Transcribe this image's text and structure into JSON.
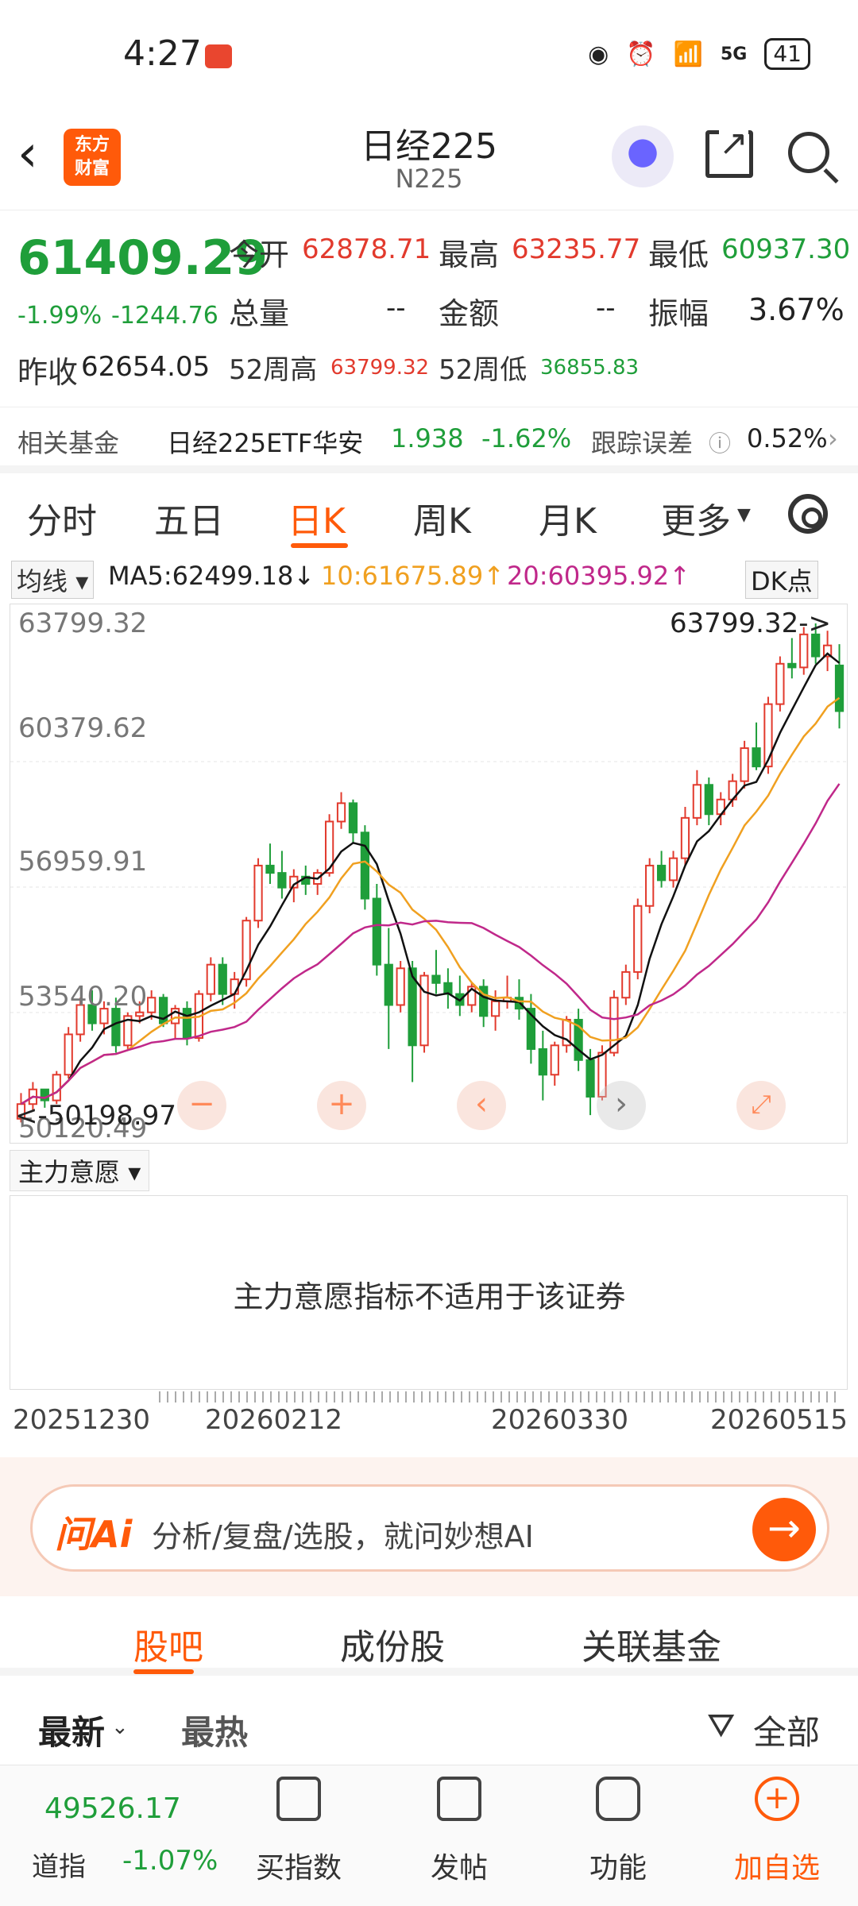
{
  "status_bar": {
    "time": "4:27",
    "network": "5G",
    "battery": "41"
  },
  "header": {
    "title": "日经225",
    "code": "N225",
    "logo_text": "东方\n财富"
  },
  "quote": {
    "price": "61409.29",
    "change_pct": "-1.99%",
    "change": "-1244.76",
    "prev_close_label": "昨收",
    "prev_close": "62654.05",
    "open_label": "今开",
    "open": "62878.71",
    "high_label": "最高",
    "high": "63235.77",
    "low_label": "最低",
    "low": "60937.30",
    "volume_label": "总量",
    "volume": "--",
    "amount_label": "金额",
    "amount": "--",
    "amplitude_label": "振幅",
    "amplitude": "3.67%",
    "high52_label": "52周高",
    "high52": "63799.32",
    "low52_label": "52周低",
    "low52": "36855.83"
  },
  "related_fund": {
    "label": "相关基金",
    "name": "日经225ETF华安",
    "price": "1.938",
    "change": "-1.62%",
    "error_label": "跟踪误差",
    "error_value": "0.52%"
  },
  "tabs": [
    "分时",
    "五日",
    "日K",
    "周K",
    "月K",
    "更多"
  ],
  "active_tab": "日K",
  "ma": {
    "selector": "均线",
    "ma5": "MA5:62499.18↓",
    "ma10": "10:61675.89↑",
    "ma20": "20:60395.92↑",
    "dk": "DK点"
  },
  "chart_data": {
    "type": "candlestick",
    "y_labels": [
      "63799.32",
      "60379.62",
      "56959.91",
      "53540.20",
      "50120.49"
    ],
    "ylim": [
      50120.49,
      63799.32
    ],
    "max_marker": "63799.32->",
    "min_marker": "<-50198.97",
    "x_labels": [
      "20251230",
      "20260212",
      "20260330",
      "20260515"
    ],
    "candles": [
      [
        50300,
        51000,
        50200,
        50700
      ],
      [
        50700,
        51300,
        50500,
        51100
      ],
      [
        51100,
        51000,
        50600,
        50800
      ],
      [
        50800,
        51600,
        50700,
        51500
      ],
      [
        51500,
        52800,
        51400,
        52600
      ],
      [
        52600,
        53600,
        52400,
        53400
      ],
      [
        53400,
        53800,
        52700,
        52900
      ],
      [
        52900,
        53500,
        52600,
        53300
      ],
      [
        53300,
        53600,
        52100,
        52300
      ],
      [
        52300,
        53200,
        52200,
        53100
      ],
      [
        53100,
        53500,
        52900,
        53200
      ],
      [
        53200,
        53800,
        53000,
        53600
      ],
      [
        53600,
        53700,
        52800,
        52900
      ],
      [
        52900,
        53400,
        52500,
        53300
      ],
      [
        53300,
        53500,
        52300,
        52500
      ],
      [
        52500,
        53800,
        52400,
        53700
      ],
      [
        53700,
        54700,
        53500,
        54500
      ],
      [
        54500,
        54700,
        53400,
        53700
      ],
      [
        53700,
        54300,
        53300,
        54100
      ],
      [
        54100,
        55800,
        53900,
        55700
      ],
      [
        55700,
        57400,
        55500,
        57200
      ],
      [
        57200,
        57800,
        56700,
        57000
      ],
      [
        57000,
        57600,
        56300,
        56600
      ],
      [
        56600,
        57100,
        56200,
        56900
      ],
      [
        56900,
        57200,
        56400,
        56700
      ],
      [
        56700,
        57100,
        56400,
        57000
      ],
      [
        57000,
        58600,
        56900,
        58400
      ],
      [
        58400,
        59200,
        58200,
        58900
      ],
      [
        58900,
        59000,
        57800,
        58100
      ],
      [
        58100,
        58300,
        56000,
        56300
      ],
      [
        56300,
        56700,
        54200,
        54500
      ],
      [
        54500,
        55500,
        52200,
        53400
      ],
      [
        53400,
        54600,
        53200,
        54400
      ],
      [
        54400,
        54600,
        51300,
        52300
      ],
      [
        52300,
        54300,
        52100,
        54200
      ],
      [
        54200,
        54900,
        53700,
        54000
      ],
      [
        54000,
        54400,
        53300,
        53700
      ],
      [
        53700,
        54200,
        53100,
        53400
      ],
      [
        53400,
        54000,
        53200,
        53900
      ],
      [
        53900,
        54100,
        52800,
        53100
      ],
      [
        53100,
        53800,
        52700,
        53500
      ],
      [
        53500,
        54200,
        53300,
        53600
      ],
      [
        53600,
        54100,
        53000,
        53300
      ],
      [
        53300,
        53700,
        51800,
        52200
      ],
      [
        52200,
        52700,
        50800,
        51500
      ],
      [
        51500,
        52400,
        51200,
        52300
      ],
      [
        52300,
        53100,
        52100,
        53000
      ],
      [
        53000,
        53300,
        51600,
        51900
      ],
      [
        51900,
        52200,
        50400,
        50900
      ],
      [
        50900,
        52300,
        50800,
        52100
      ],
      [
        52100,
        53800,
        52000,
        53600
      ],
      [
        53600,
        54500,
        53400,
        54300
      ],
      [
        54300,
        56300,
        54100,
        56100
      ],
      [
        56100,
        57400,
        55900,
        57200
      ],
      [
        57200,
        57600,
        56600,
        56800
      ],
      [
        56800,
        57600,
        56600,
        57400
      ],
      [
        57400,
        58800,
        57200,
        58500
      ],
      [
        58500,
        59800,
        58300,
        59400
      ],
      [
        59400,
        59600,
        58300,
        58600
      ],
      [
        58600,
        59200,
        58300,
        59000
      ],
      [
        59000,
        59700,
        58800,
        59500
      ],
      [
        59500,
        60600,
        59300,
        60400
      ],
      [
        60400,
        61100,
        59800,
        59900
      ],
      [
        59900,
        61800,
        59700,
        61600
      ],
      [
        61600,
        62900,
        61400,
        62700
      ],
      [
        62700,
        63400,
        62300,
        62600
      ],
      [
        62600,
        63700,
        62400,
        63500
      ],
      [
        63500,
        63800,
        62700,
        62900
      ],
      [
        62900,
        63600,
        62500,
        63200
      ],
      [
        62654,
        63235,
        60937,
        61409
      ]
    ]
  },
  "ind": {
    "label": "主力意愿",
    "message": "主力意愿指标不适用于该证券"
  },
  "ai": {
    "logo": "问Ai",
    "placeholder": "分析/复盘/选股，就问妙想AI"
  },
  "subtabs": [
    "股吧",
    "成份股",
    "关联基金"
  ],
  "sort": {
    "latest": "最新",
    "hot": "最热",
    "all": "全部"
  },
  "bottom_nav": {
    "index_value": "49526.17",
    "index_name": "道指",
    "index_change": "-1.07%",
    "items": [
      "买指数",
      "发帖",
      "功能",
      "加自选"
    ]
  }
}
